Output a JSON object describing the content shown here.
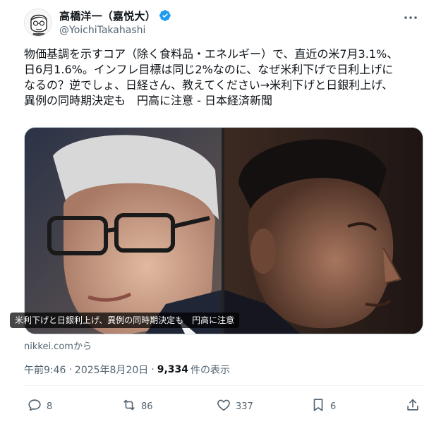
{
  "author": {
    "display_name": "高橋洋一（嘉悦大）",
    "handle": "@YoichiTakahashi",
    "verified": true
  },
  "tweet": {
    "text": "物価基調を示すコア（除く食料品・エネルギー）で、直近の米7月3.1%、\n日6月1.6%。インフレ目標は同じ2%なのに、なぜ米利下げで日利上げに\nなるの？逆でしょ、日経さん、教えてください→米利下げと日銀利上げ、\n異例の同時期決定も　円高に注意 - 日本経済新聞"
  },
  "card": {
    "caption": "米利下げと日銀利上げ、異例の同時期決定も　円高に注意",
    "source": "nikkei.comから"
  },
  "meta": {
    "time": "午前9:46",
    "date": "2025年8月20日",
    "separator": "·",
    "views": "9,334",
    "views_label": "件の表示"
  },
  "actions": {
    "replies": "8",
    "retweets": "86",
    "likes": "337",
    "bookmarks": "6"
  },
  "colors": {
    "verified_blue": "#1d9bf0",
    "secondary_text": "#536471",
    "primary_text": "#0f1419"
  },
  "icons": [
    "more-icon",
    "verified-icon",
    "reply-icon",
    "retweet-icon",
    "like-icon",
    "bookmark-icon",
    "share-icon"
  ]
}
